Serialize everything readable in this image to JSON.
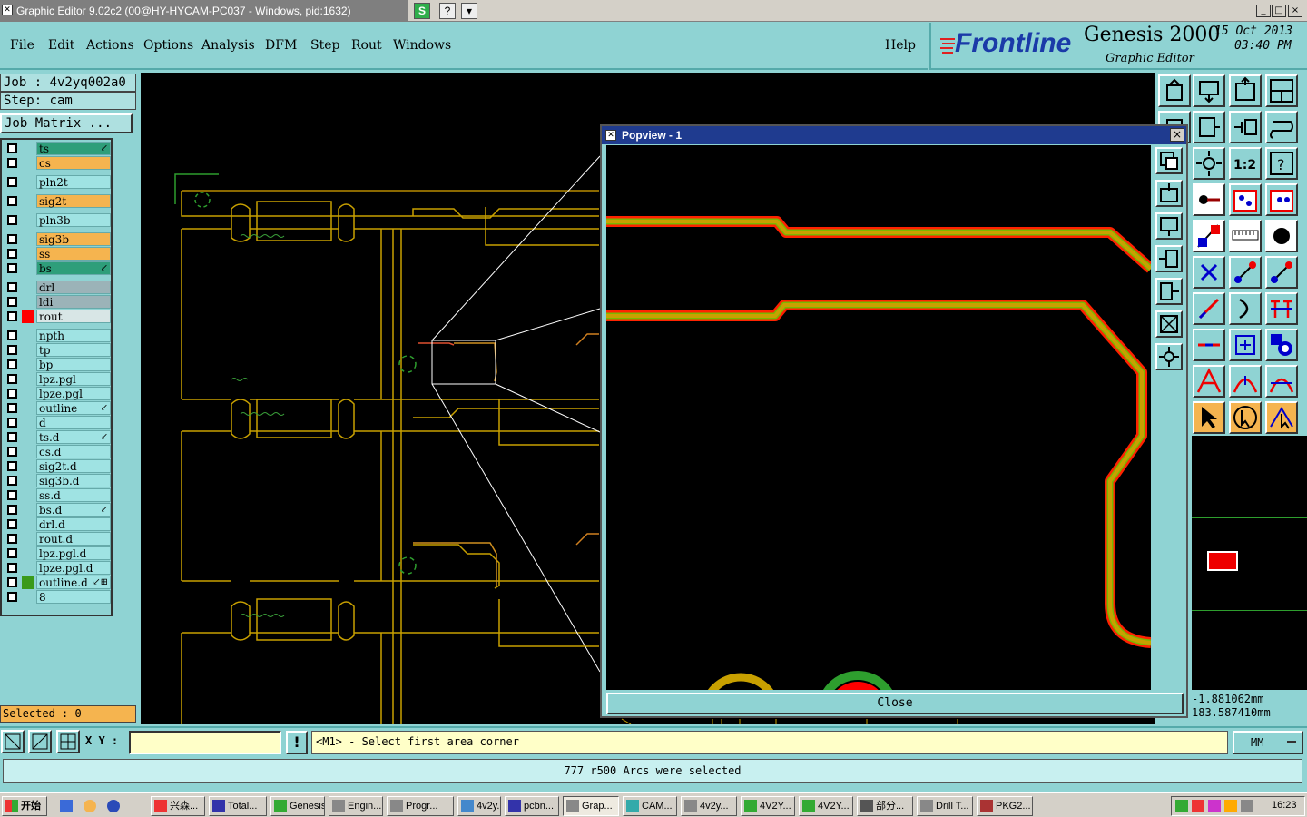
{
  "window": {
    "title": "Graphic Editor 9.02c2 (00@HY-HYCAM-PC037 - Windows, pid:1632)",
    "s_icon": "S",
    "help_icon": "?",
    "minimize": "_",
    "maximize": "□",
    "close": "×"
  },
  "menu": {
    "file": "File",
    "edit": "Edit",
    "actions": "Actions",
    "options": "Options",
    "analysis": "Analysis",
    "dfm": "DFM",
    "step": "Step",
    "rout": "Rout",
    "windows": "Windows",
    "help": "Help"
  },
  "brand": {
    "logo": "Frontline",
    "product": "Genesis 2000",
    "subtitle": "Graphic Editor",
    "date": "15 Oct 2013",
    "time": "03:40 PM"
  },
  "job": {
    "job_label": "Job : 4v2yq002a0",
    "step_label": "Step: cam",
    "matrix_button": "Job Matrix ..."
  },
  "layers": [
    {
      "name": "ts",
      "color": "#2e9e7a",
      "mark": "↙"
    },
    {
      "name": "cs",
      "color": "#f5b44f",
      "mark": ""
    },
    {
      "name": "pln2t",
      "color": "#9fe3e3",
      "mark": ""
    },
    {
      "name": "sig2t",
      "color": "#f5b44f",
      "mark": ""
    },
    {
      "name": "pln3b",
      "color": "#9fe3e3",
      "mark": ""
    },
    {
      "name": "sig3b",
      "color": "#f5b44f",
      "mark": ""
    },
    {
      "name": "ss",
      "color": "#f5b44f",
      "mark": ""
    },
    {
      "name": "bs",
      "color": "#2e9e7a",
      "mark": "↙"
    },
    {
      "name": "drl",
      "color": "#9bb3b8",
      "mark": ""
    },
    {
      "name": "ldi",
      "color": "#9bb3b8",
      "mark": ""
    },
    {
      "name": "rout",
      "color": "#d8e6e6",
      "mark": "",
      "swatch": "#ff0000"
    },
    {
      "name": "npth",
      "color": "#9fe3e3",
      "mark": ""
    },
    {
      "name": "tp",
      "color": "#9fe3e3",
      "mark": ""
    },
    {
      "name": "bp",
      "color": "#9fe3e3",
      "mark": ""
    },
    {
      "name": "lpz.pgl",
      "color": "#9fe3e3",
      "mark": ""
    },
    {
      "name": "lpze.pgl",
      "color": "#9fe3e3",
      "mark": ""
    },
    {
      "name": "outline",
      "color": "#9fe3e3",
      "mark": "↙"
    },
    {
      "name": "d",
      "color": "#9fe3e3",
      "mark": ""
    },
    {
      "name": "ts.d",
      "color": "#9fe3e3",
      "mark": "↙"
    },
    {
      "name": "cs.d",
      "color": "#9fe3e3",
      "mark": ""
    },
    {
      "name": "sig2t.d",
      "color": "#9fe3e3",
      "mark": ""
    },
    {
      "name": "sig3b.d",
      "color": "#9fe3e3",
      "mark": ""
    },
    {
      "name": "ss.d",
      "color": "#9fe3e3",
      "mark": ""
    },
    {
      "name": "bs.d",
      "color": "#9fe3e3",
      "mark": "↙"
    },
    {
      "name": "drl.d",
      "color": "#9fe3e3",
      "mark": ""
    },
    {
      "name": "rout.d",
      "color": "#9fe3e3",
      "mark": ""
    },
    {
      "name": "lpz.pgl.d",
      "color": "#9fe3e3",
      "mark": ""
    },
    {
      "name": "lpze.pgl.d",
      "color": "#9fe3e3",
      "mark": ""
    },
    {
      "name": "outline.d",
      "color": "#9fe3e3",
      "mark": "↙⊞",
      "swatch": "#3a9a1a"
    },
    {
      "name": "8",
      "color": "#9fe3e3",
      "mark": ""
    }
  ],
  "selected": "Selected : 0",
  "popview": {
    "title": "Popview - 1",
    "close_label": "Close"
  },
  "coords": {
    "x": "-1.881062mm",
    "y": "183.587410mm"
  },
  "command": {
    "xy_label": "X Y :",
    "xy_value": "",
    "prompt": "<M1> - Select first area corner",
    "unit": "MM"
  },
  "status": "777 r500 Arcs were selected",
  "taskbar": {
    "start": "开始",
    "clock": "16:23",
    "items": [
      "兴森...",
      "Total...",
      "Genesis",
      "Engin...",
      "Progr...",
      "4v2y...",
      "pcbn...",
      "Grap...",
      "CAM...",
      "4v2y...",
      "4V2Y...",
      "4V2Y...",
      "部分...",
      "Drill T...",
      "PKG2..."
    ]
  },
  "colors": {
    "panel": "#8fd3d3",
    "trace_orange": "#c8a000",
    "trace_red": "#ff2200",
    "trace_green": "#7ab800"
  }
}
